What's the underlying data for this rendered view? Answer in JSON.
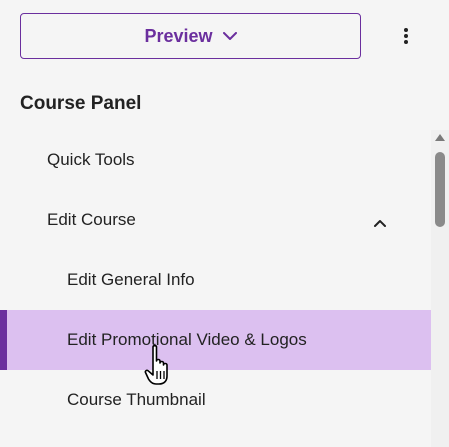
{
  "header": {
    "preview_label": "Preview"
  },
  "panel": {
    "title": "Course Panel"
  },
  "nav": {
    "items": [
      {
        "label": "Quick Tools"
      },
      {
        "label": "Edit Course"
      },
      {
        "label": "Edit General Info"
      },
      {
        "label": "Edit Promotional Video & Logos"
      },
      {
        "label": "Course Thumbnail"
      }
    ]
  },
  "colors": {
    "accent": "#6b2f9e",
    "active_bg": "#dcc0f0",
    "background": "#f5f5f5"
  },
  "icons": {
    "preview_dropdown": "chevron-down-icon",
    "more": "vertical-dots-icon",
    "section_toggle": "chevron-up-icon",
    "pointer": "hand-pointer-icon"
  }
}
